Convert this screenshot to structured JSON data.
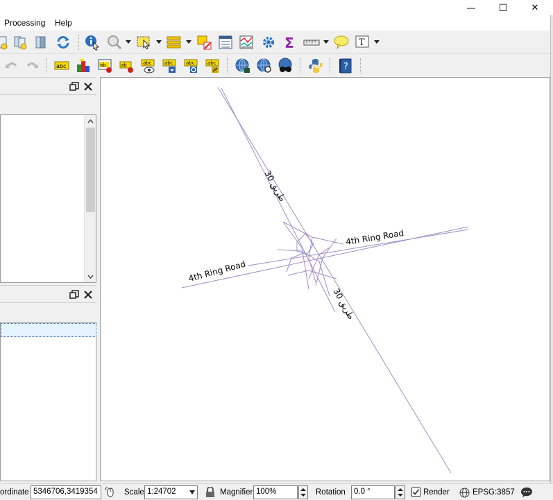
{
  "window": {
    "minimize_glyph": "—",
    "maximize_glyph": "☐",
    "close_glyph": "✕"
  },
  "menu": {
    "items": [
      {
        "label": "Processing"
      },
      {
        "label": "Help"
      }
    ]
  },
  "map": {
    "labels": {
      "road30_north": "طريق 30",
      "road30_south": "طريق 30",
      "ring_east": "4th Ring Road",
      "ring_west": "4th Ring Road"
    },
    "line_color": "#9e8fc4"
  },
  "statusbar": {
    "coordinate_label": "ordinate",
    "coordinate_value": "5346706,3419354",
    "scale_label": "Scale",
    "scale_value": "1:24702",
    "magnifier_label": "Magnifier",
    "magnifier_value": "100%",
    "rotation_label": "Rotation",
    "rotation_value": "0.0 °",
    "render_label": "Render",
    "render_checked": true,
    "crs_label": "EPSG:3857"
  },
  "icons": {
    "toolbar1": [
      "new-print-layout-icon",
      "layout-manager-icon",
      "show-layouts-icon",
      "refresh-icon",
      "identify-icon",
      "zoom-action-icon",
      "select-features-icon",
      "attribute-table-icon",
      "deselect-icon",
      "open-attribute-table-icon",
      "statistics-icon",
      "processing-toolbox-icon",
      "field-calculator-sum-icon",
      "measure-icon",
      "map-tips-icon",
      "text-annotation-icon"
    ],
    "toolbar2": [
      "undo-icon",
      "redo-icon",
      "label-abc-icon",
      "diagram-icon",
      "pin-label-icon",
      "highlight-pinned-icon",
      "show-hide-labels-icon",
      "move-label-icon",
      "rotate-label-icon",
      "change-label-icon",
      "metasearch-icon",
      "search-web-icon",
      "binoculars-icon",
      "python-console-icon",
      "help-book-icon"
    ]
  }
}
